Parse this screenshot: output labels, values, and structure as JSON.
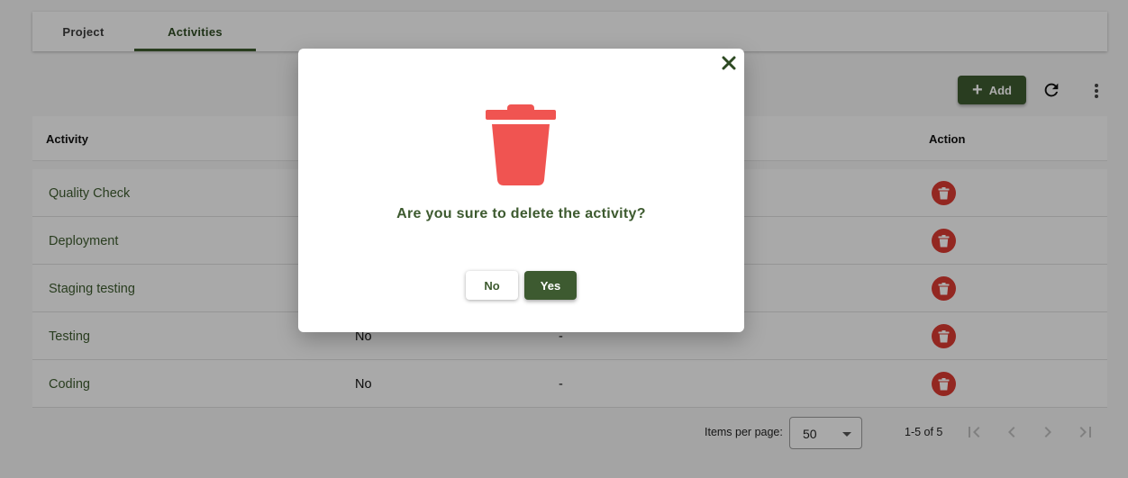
{
  "tabs": [
    {
      "label": "Project",
      "active": false
    },
    {
      "label": "Activities",
      "active": true
    }
  ],
  "toolbar": {
    "add_label": "Add",
    "add_icon": "plus-icon",
    "refresh_icon": "refresh-icon",
    "more_icon": "more-vert-icon"
  },
  "table": {
    "columns": [
      "Activity",
      "Action"
    ],
    "rows": [
      {
        "name": "Quality Check",
        "optional": "",
        "description": ""
      },
      {
        "name": "Deployment",
        "optional": "",
        "description": ""
      },
      {
        "name": "Staging testing",
        "optional": "",
        "description": ""
      },
      {
        "name": "Testing",
        "optional": "No",
        "description": "-"
      },
      {
        "name": "Coding",
        "optional": "No",
        "description": "-"
      }
    ]
  },
  "paginator": {
    "items_per_page_label": "Items per page:",
    "items_per_page_value": "50",
    "range_label": "1-5 of 5"
  },
  "dialog": {
    "message": "Are you sure to delete the activity?",
    "no_label": "No",
    "yes_label": "Yes",
    "icon": "trash-icon"
  },
  "colors": {
    "primary": "#3d5a30",
    "danger": "#d93a32",
    "trash_icon": "#f05451"
  }
}
